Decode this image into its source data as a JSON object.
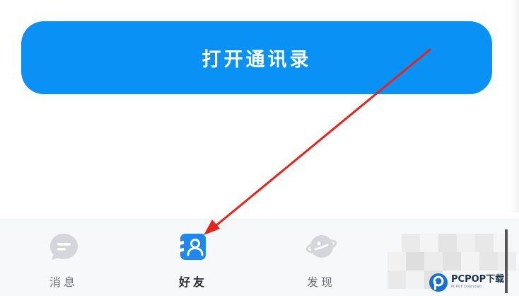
{
  "primary_action": {
    "label": "打开通讯录"
  },
  "tabbar": {
    "tabs": [
      {
        "id": "messages",
        "label": "消息",
        "icon": "chat-bubble-icon",
        "active": false
      },
      {
        "id": "friends",
        "label": "好友",
        "icon": "friends-icon",
        "active": true
      },
      {
        "id": "discover",
        "label": "发现",
        "icon": "planet-icon",
        "active": false
      }
    ]
  },
  "annotation": {
    "arrow_color": "#e8221c",
    "description": "red arrow pointing from button to 好友 tab"
  },
  "watermark": {
    "main": "PCPOP下载",
    "sub": "PCPOP Download"
  },
  "colors": {
    "accent": "#0a91f5",
    "tab_inactive": "#d4d6db",
    "tab_active": "#1e88f0"
  }
}
